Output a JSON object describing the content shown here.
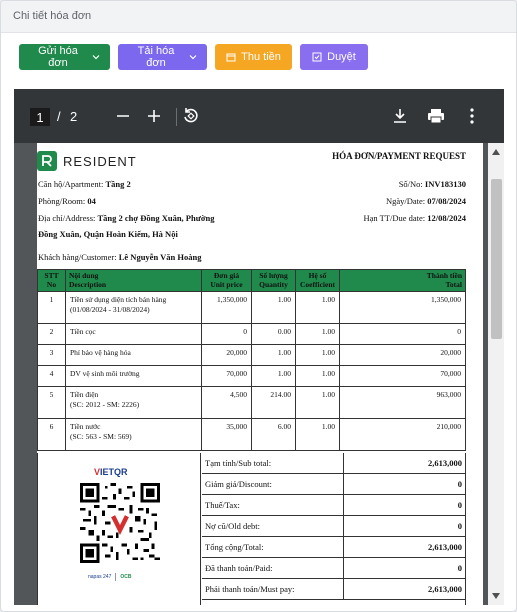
{
  "window": {
    "title": "Chi tiết hóa đơn"
  },
  "toolbar": {
    "send_label": "Gửi hóa đơn",
    "download_label": "Tải hóa đơn",
    "collect_label": "Thu tiền",
    "approve_label": "Duyệt",
    "colors": {
      "green": "#1f8a4c",
      "purple": "#7b68ee",
      "orange": "#f5a623",
      "violet": "#8a6ef0"
    }
  },
  "viewer": {
    "current_page": "1",
    "separator": "/",
    "total_pages": "2",
    "icons": [
      "zoom-out-icon",
      "zoom-in-icon",
      "rotate-icon",
      "download-icon",
      "print-icon",
      "more-icon"
    ]
  },
  "invoice": {
    "brand": "RESIDENT",
    "doc_title": "HÓA ĐƠN/PAYMENT REQUEST",
    "apartment_label": "Căn hộ/Apartment:",
    "apartment_value": "Tầng 2",
    "room_label": "Phòng/Room:",
    "room_value": "04",
    "address_label": "Địa chỉ/Address:",
    "address_value_1": "Tầng 2 chợ Đồng Xuân, Phường",
    "address_value_2": "Đồng Xuân, Quận Hoàn Kiếm, Hà Nội",
    "no_label": "Số/No:",
    "no_value": "INV183130",
    "date_label": "Ngày/Date:",
    "date_value": "07/08/2024",
    "due_label": "Hạn TT/Due date:",
    "due_value": "12/08/2024",
    "customer_label": "Khách hàng/Customer:",
    "customer_value": "Lê Nguyễn Văn Hoàng",
    "table": {
      "headers": [
        {
          "vi": "STT",
          "en": "No"
        },
        {
          "vi": "Nội dung",
          "en": "Description"
        },
        {
          "vi": "Đơn giá",
          "en": "Unit price"
        },
        {
          "vi": "Số lượng",
          "en": "Quantity"
        },
        {
          "vi": "Hệ số",
          "en": "Coefficient"
        },
        {
          "vi": "Thành tiền",
          "en": "Total"
        }
      ],
      "rows": [
        {
          "no": "1",
          "desc": "Tiền sử dụng diện tích bán hàng",
          "desc2": "(01/08/2024 - 31/08/2024)",
          "unit": "1,350,000",
          "qty": "1.00",
          "coef": "1.00",
          "total": "1,350,000"
        },
        {
          "no": "2",
          "desc": "Tiền cọc",
          "desc2": "",
          "unit": "0",
          "qty": "0.00",
          "coef": "1.00",
          "total": "0"
        },
        {
          "no": "3",
          "desc": "Phí bảo vệ hàng hóa",
          "desc2": "",
          "unit": "20,000",
          "qty": "1.00",
          "coef": "1.00",
          "total": "20,000"
        },
        {
          "no": "4",
          "desc": "DV vệ sinh môi trường",
          "desc2": "",
          "unit": "70,000",
          "qty": "1.00",
          "coef": "1.00",
          "total": "70,000"
        },
        {
          "no": "5",
          "desc": "Tiền điện",
          "desc2": "(SC: 2012 - SM: 2226)",
          "unit": "4,500",
          "qty": "214.00",
          "coef": "1.00",
          "total": "963,000"
        },
        {
          "no": "6",
          "desc": "Tiền nước",
          "desc2": "(SC: 563 - SM: 569)",
          "unit": "35,000",
          "qty": "6.00",
          "coef": "1.00",
          "total": "210,000"
        }
      ]
    },
    "summary": [
      {
        "label": "Tạm tính/Sub total:",
        "value": "2,613,000"
      },
      {
        "label": "Giảm giá/Discount:",
        "value": "0"
      },
      {
        "label": "Thuế/Tax:",
        "value": "0"
      },
      {
        "label": "Nợ cũ/Old debt:",
        "value": "0"
      },
      {
        "label": "Tổng cộng/Total:",
        "value": "2,613,000"
      },
      {
        "label": "Đã thanh toán/Paid:",
        "value": "0"
      },
      {
        "label": "Phải thanh toán/Must pay:",
        "value": "2,613,000"
      }
    ],
    "qr": {
      "brand_red": "V",
      "brand_rest": "IETQR",
      "bank1": "napas 247",
      "bank2": "OCB"
    }
  }
}
